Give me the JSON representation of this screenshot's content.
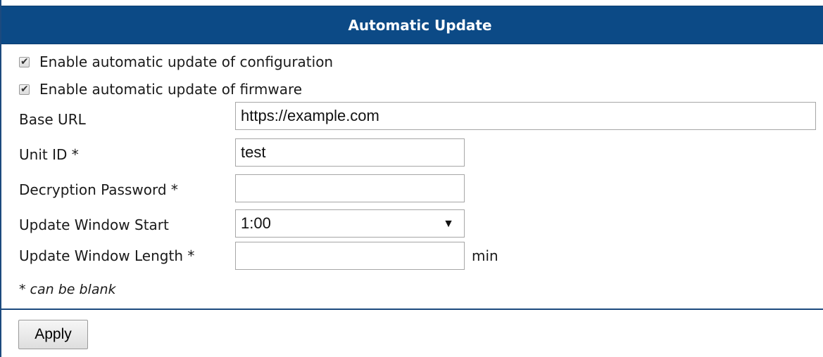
{
  "header": {
    "title": "Automatic Update"
  },
  "checkboxes": [
    {
      "label": "Enable automatic update of configuration",
      "checked": true
    },
    {
      "label": "Enable automatic update of firmware",
      "checked": true
    }
  ],
  "fields": {
    "base_url": {
      "label": "Base URL",
      "value": "https://example.com"
    },
    "unit_id": {
      "label": "Unit ID *",
      "value": "test"
    },
    "decryption_password": {
      "label": "Decryption Password *",
      "value": ""
    },
    "window_start": {
      "label": "Update Window Start",
      "value": "1:00"
    },
    "window_length": {
      "label": "Update Window Length *",
      "value": "",
      "unit": "min"
    }
  },
  "note": "* can be blank",
  "apply_label": "Apply",
  "colors": {
    "header_bg": "#0c4a86",
    "header_text": "#ffffff",
    "border": "#1c4a7e"
  },
  "icons": {
    "checkmark": "check-icon",
    "dropdown": "dropdown-arrow-icon"
  }
}
